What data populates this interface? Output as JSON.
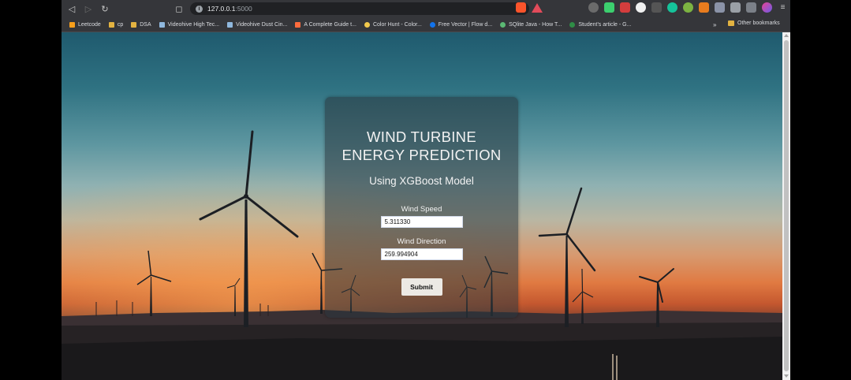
{
  "browser": {
    "url_host": "127.0.0.1",
    "url_port": ":5000"
  },
  "bookmarks": [
    {
      "label": "Leetcode",
      "icon": "leetcode-icon",
      "color": "#f89f1b"
    },
    {
      "label": "cp",
      "icon": "folder-icon",
      "color": "#e3b341"
    },
    {
      "label": "DSA",
      "icon": "folder-icon",
      "color": "#e3b341"
    },
    {
      "label": "Videohive High Tec...",
      "icon": "videohive-icon",
      "color": "#8fb8de"
    },
    {
      "label": "Videohive Dust Cin...",
      "icon": "videohive-icon",
      "color": "#8fb8de"
    },
    {
      "label": "A Complete Guide t...",
      "icon": "star-icon",
      "color": "#ff6b3d"
    },
    {
      "label": "Color Hunt - Color...",
      "icon": "colorhunt-icon",
      "color": "#f2c94c"
    },
    {
      "label": "Free Vector | Flow d...",
      "icon": "freepik-icon",
      "color": "#1273eb"
    },
    {
      "label": "SQlite Java - How T...",
      "icon": "sqlite-icon",
      "color": "#5bb974"
    },
    {
      "label": "Student's article - G...",
      "icon": "gfg-icon",
      "color": "#2f8d46"
    }
  ],
  "bookmarks_more": "»",
  "other_bookmarks": "Other bookmarks",
  "form": {
    "title_line1": "WIND TURBINE",
    "title_line2": "ENERGY PREDICTION",
    "subtitle": "Using XGBoost Model",
    "wind_speed_label": "Wind Speed",
    "wind_speed_value": "5.311330",
    "wind_direction_label": "Wind Direction",
    "wind_direction_value": "259.994904",
    "submit_label": "Submit"
  },
  "colors": {
    "card_bg": "rgba(40,52,60,0.55)",
    "toolbar": "#35363a"
  }
}
